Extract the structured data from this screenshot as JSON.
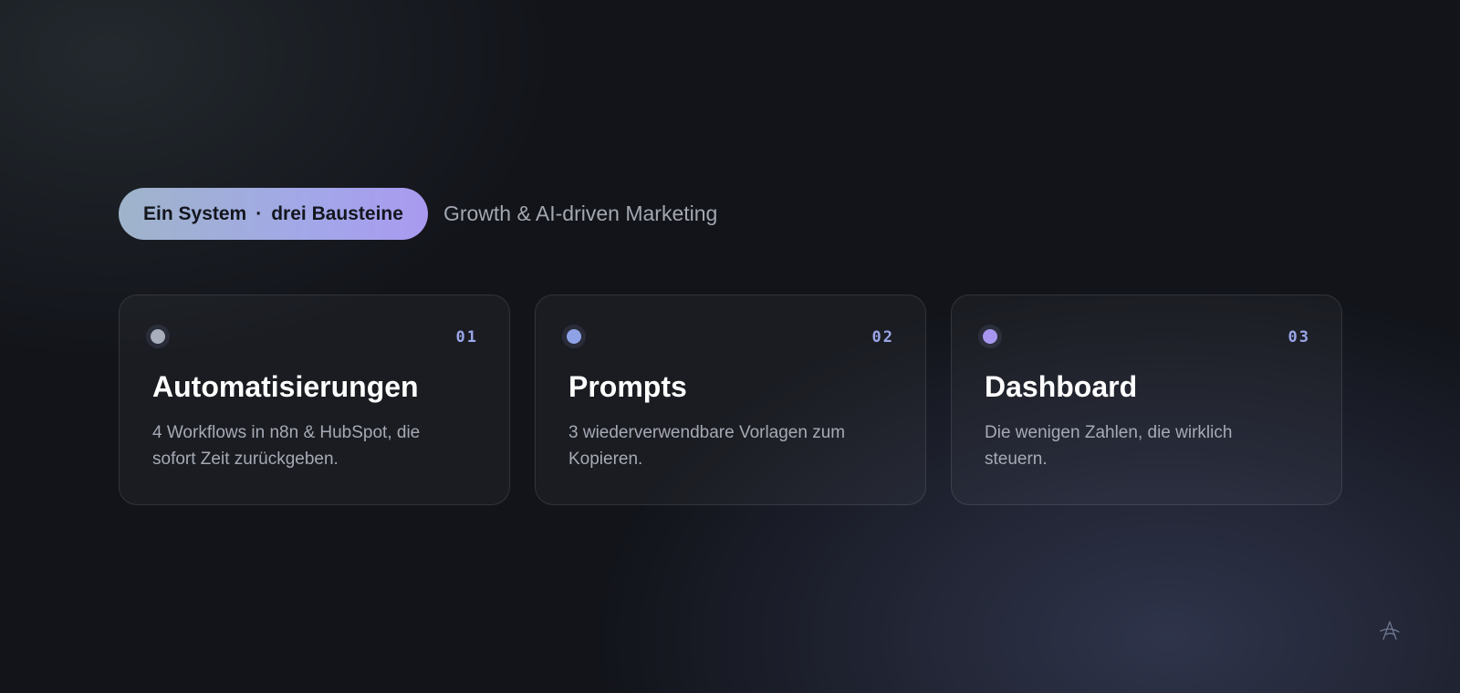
{
  "header": {
    "badge_part1": "Ein System",
    "badge_separator": "·",
    "badge_part2": "drei Bausteine",
    "tagline": "Growth & AI-driven Marketing"
  },
  "cards": [
    {
      "number": "01",
      "title": "Automatisierungen",
      "description": "4 Workflows in n8n & HubSpot, die sofort Zeit zurückgeben.",
      "dot_color": "#a9aebc"
    },
    {
      "number": "02",
      "title": "Prompts",
      "description": "3 wiederverwendbare Vorlagen zum Kopieren.",
      "dot_color": "#8fa2e6"
    },
    {
      "number": "03",
      "title": "Dashboard",
      "description": "Die wenigen Zahlen, die wirklich steuern.",
      "dot_color": "#a897ef"
    }
  ],
  "colors": {
    "background": "#12141a",
    "accent_start": "#9fb4ca",
    "accent_end": "#a99af0",
    "number_color": "#9aa6e8"
  },
  "icons": {
    "corner_logo": "brand-logo-icon"
  }
}
